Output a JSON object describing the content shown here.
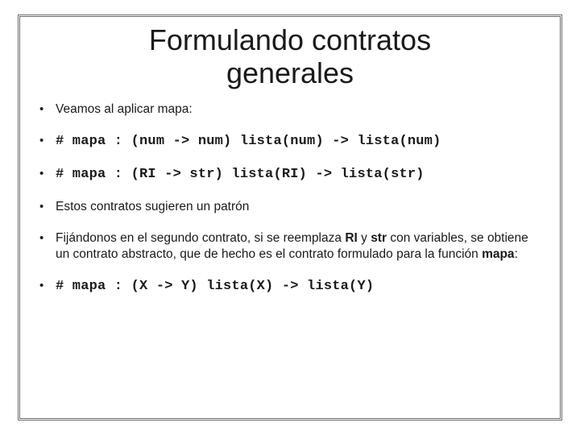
{
  "title_line1": "Formulando contratos",
  "title_line2": "generales",
  "bullets": {
    "b0": "Veamos al aplicar mapa:",
    "b1": "# mapa : (num -> num) lista(num) -> lista(num)",
    "b2": "# mapa : (RI -> str) lista(RI) -> lista(str)",
    "b3": "Estos contratos sugieren un patrón",
    "b4_pre": "Fijándonos en el segundo contrato, si se reemplaza ",
    "b4_ri": "RI",
    "b4_mid1": " y ",
    "b4_str": "str",
    "b4_mid2": " con variables, se obtiene un contrato abstracto, que de hecho es el contrato formulado para la función ",
    "b4_mapa": "mapa",
    "b4_post": ":",
    "b5": "# mapa : (X -> Y) lista(X) -> lista(Y)"
  }
}
